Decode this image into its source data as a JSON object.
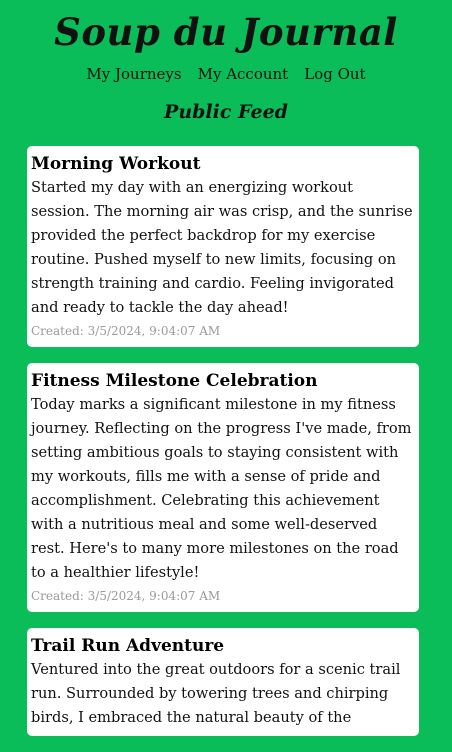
{
  "app": {
    "title": "Soup du Journal"
  },
  "nav": {
    "items": [
      {
        "label": "My Journeys"
      },
      {
        "label": "My Account"
      },
      {
        "label": "Log Out"
      }
    ]
  },
  "feed": {
    "title": "Public Feed",
    "posts": [
      {
        "title": "Morning Workout",
        "body": "Started my day with an energizing workout session. The morning air was crisp, and the sunrise provided the perfect backdrop for my exercise routine. Pushed myself to new limits, focusing on strength training and cardio. Feeling invigorated and ready to tackle the day ahead!",
        "created": "Created: 3/5/2024, 9:04:07 AM"
      },
      {
        "title": "Fitness Milestone Celebration",
        "body": "Today marks a significant milestone in my fitness journey. Reflecting on the progress I've made, from setting ambitious goals to staying consistent with my workouts, fills me with a sense of pride and accomplishment. Celebrating this achievement with a nutritious meal and some well-deserved rest. Here's to many more milestones on the road to a healthier lifestyle!",
        "created": "Created: 3/5/2024, 9:04:07 AM"
      },
      {
        "title": "Trail Run Adventure",
        "body": "Ventured into the great outdoors for a scenic trail run. Surrounded by towering trees and chirping birds, I embraced the natural beauty of the",
        "created": ""
      }
    ]
  },
  "colors": {
    "background": "#0bbd58",
    "card": "#ffffff",
    "meta_text": "#9a9a9a"
  }
}
